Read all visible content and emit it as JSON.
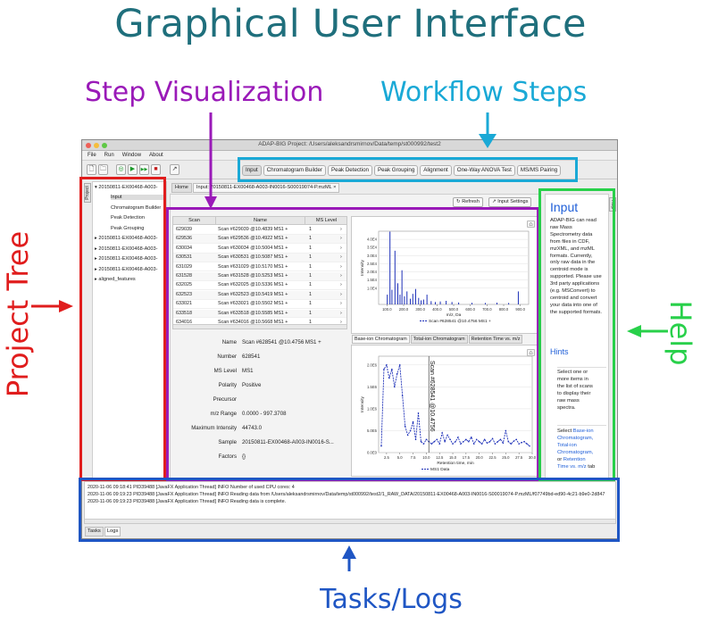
{
  "annotations": {
    "title": "Graphical User Interface",
    "step_visualization": "Step Visualization",
    "workflow_steps": "Workflow Steps",
    "project_tree": "Project Tree",
    "help": "Help",
    "tasks_logs": "Tasks/Logs",
    "colors": {
      "title": "#1f6f7c",
      "project_tree": "#e01d1d",
      "step_visualization": "#9a1ab8",
      "workflow_steps": "#1aa9d6",
      "help": "#28d04a",
      "tasks_logs": "#1f56c4"
    }
  },
  "window": {
    "title": "ADAP-BIG Project: /Users/aleksandrsmirnov/Data/temp/st000992/test2",
    "menu": [
      "File",
      "Run",
      "Window",
      "About"
    ],
    "toolbar_icons": [
      "new-file-icon",
      "open-folder-icon",
      "run-step-icon",
      "play-icon",
      "fast-forward-icon",
      "stop-icon",
      "pin-icon"
    ],
    "toolbar_glyphs": [
      "🗋",
      "🗀",
      "◎",
      "▶",
      "▶▶",
      "■",
      "↗"
    ],
    "workflow_steps": [
      "Input",
      "Chromatogram Builder",
      "Peak Detection",
      "Peak Grouping",
      "Alignment",
      "One-Way ANOVA Test",
      "MS/MS Pairing"
    ],
    "active_step": "Input"
  },
  "project_tree": {
    "tab_label": "Project",
    "nodes": [
      {
        "label": "▾ 20150811-EX00468-A003-",
        "selected": false
      },
      {
        "label": "Input",
        "selected": true
      },
      {
        "label": "Chromatogram Builder",
        "selected": false
      },
      {
        "label": "Peak Detection",
        "selected": false
      },
      {
        "label": "Peak Grouping",
        "selected": false
      },
      {
        "label": "▸ 20150811-EX00468-A003-",
        "selected": false
      },
      {
        "label": "▸ 20150811-EX00468-A003-",
        "selected": false
      },
      {
        "label": "▸ 20150811-EX00468-A003-",
        "selected": false
      },
      {
        "label": "▸ 20150811-EX00468-A003-",
        "selected": false
      },
      {
        "label": "▸ aligned_features",
        "selected": false
      }
    ]
  },
  "center": {
    "tabs": [
      "Home",
      "Input: 20150811-EX00468-A003-IN0016-S00019074-P.mzML ×"
    ],
    "refresh_label": "Refresh",
    "input_settings_label": "Input Settings",
    "table": {
      "columns": [
        "Scan",
        "Name",
        "MS Level"
      ],
      "rows": [
        [
          "629039",
          "Scan #629039 @10.4839 MS1 +",
          "1"
        ],
        [
          "629536",
          "Scan #629536 @10.4922 MS1 +",
          "1"
        ],
        [
          "630034",
          "Scan #630034 @10.5004 MS1 +",
          "1"
        ],
        [
          "630531",
          "Scan #630531 @10.5087 MS1 +",
          "1"
        ],
        [
          "631029",
          "Scan #631029 @10.5170 MS1 +",
          "1"
        ],
        [
          "631528",
          "Scan #631528 @10.5253 MS1 +",
          "1"
        ],
        [
          "632025",
          "Scan #632025 @10.5336 MS1 +",
          "1"
        ],
        [
          "632523",
          "Scan #632523 @10.5419 MS1 +",
          "1"
        ],
        [
          "633021",
          "Scan #633021 @10.5502 MS1 +",
          "1"
        ],
        [
          "633518",
          "Scan #633518 @10.5585 MS1 +",
          "1"
        ],
        [
          "634016",
          "Scan #634016 @10.5668 MS1 +",
          "1"
        ]
      ]
    },
    "details": [
      {
        "label": "Name",
        "value": "Scan #628541 @10.4756 MS1 +"
      },
      {
        "label": "Number",
        "value": "628541"
      },
      {
        "label": "MS Level",
        "value": "MS1"
      },
      {
        "label": "Polarity",
        "value": "Positive"
      },
      {
        "label": "Precursor",
        "value": ""
      },
      {
        "label": "m/z Range",
        "value": "0.0000 - 997.3708"
      },
      {
        "label": "Maximum Intensity",
        "value": "44743.0"
      },
      {
        "label": "Sample",
        "value": "20150811-EX00468-A003-IN0016-S..."
      },
      {
        "label": "Factors",
        "value": "{}"
      }
    ],
    "chromatogram_tabs": [
      "Base-ion Chromatogram",
      "Total-ion Chromatogram",
      "Retention Time vs. m/z"
    ]
  },
  "chart_data": [
    {
      "type": "bar",
      "xlabel": "m/z, Da",
      "ylabel": "Intensity",
      "x_ticks": [
        "100.0",
        "200.0",
        "300.0",
        "400.0",
        "500.0",
        "600.0",
        "700.0",
        "800.0",
        "900.0"
      ],
      "y_ticks": [
        "1.0E4",
        "1.5E4",
        "2.0E4",
        "2.5E4",
        "3.0E4",
        "3.5E4",
        "4.0E4"
      ],
      "xlim": [
        50,
        950
      ],
      "ylim": [
        0,
        45000
      ],
      "legend": "Scan #628541 @10.4756 MS1 +",
      "x": [
        102,
        118,
        130,
        148,
        165,
        178,
        190,
        205,
        220,
        240,
        255,
        272,
        290,
        305,
        320,
        340,
        365,
        390,
        420,
        455,
        490,
        530,
        610,
        690,
        760,
        830,
        888
      ],
      "y": [
        6000,
        44743,
        9000,
        33000,
        13000,
        6000,
        21000,
        5000,
        8000,
        3500,
        6500,
        9500,
        4000,
        2500,
        3000,
        6000,
        2000,
        1500,
        1800,
        2200,
        1500,
        1200,
        1000,
        900,
        1100,
        900,
        8000
      ]
    },
    {
      "type": "line",
      "xlabel": "Retention time, min",
      "ylabel": "Intensity",
      "x_ticks": [
        "2.5",
        "5.0",
        "7.5",
        "10.0",
        "12.5",
        "15.0",
        "17.5",
        "20.0",
        "22.5",
        "25.0",
        "27.5",
        "30.0"
      ],
      "y_ticks": [
        "0.0E0",
        "5.0E5",
        "1.0E6",
        "1.5E6",
        "2.0E6"
      ],
      "xlim": [
        1,
        30
      ],
      "ylim": [
        0,
        2200000
      ],
      "legend": "MS1 Data",
      "marker_label": "Scan #628541 @10.4756",
      "marker_x": 10.4756,
      "x": [
        1.5,
        2.0,
        2.5,
        3.0,
        3.5,
        4.0,
        4.5,
        5.0,
        5.5,
        6.0,
        6.5,
        7.0,
        7.5,
        8.0,
        8.5,
        9.0,
        9.5,
        10.0,
        10.5,
        11.0,
        11.5,
        12.0,
        12.5,
        13.0,
        13.5,
        14.0,
        14.5,
        15.0,
        15.5,
        16.0,
        16.5,
        17.0,
        17.5,
        18.0,
        18.5,
        19.0,
        19.5,
        20.0,
        20.5,
        21.0,
        21.5,
        22.0,
        22.5,
        23.0,
        23.5,
        24.0,
        24.5,
        25.0,
        25.5,
        26.0,
        26.5,
        27.0,
        27.5,
        28.0,
        28.5,
        29.0,
        29.5
      ],
      "y": [
        150000,
        1900000,
        2000000,
        1700000,
        1900000,
        1500000,
        1800000,
        2000000,
        1300000,
        600000,
        400000,
        500000,
        700000,
        300000,
        900000,
        250000,
        200000,
        300000,
        250000,
        200000,
        250000,
        300000,
        200000,
        450000,
        250000,
        400000,
        300000,
        200000,
        250000,
        350000,
        200000,
        250000,
        300000,
        250000,
        350000,
        200000,
        300000,
        250000,
        200000,
        300000,
        220000,
        250000,
        320000,
        200000,
        250000,
        300000,
        220000,
        500000,
        250000,
        200000,
        260000,
        300000,
        200000,
        230000,
        250000,
        200000,
        150000
      ]
    }
  ],
  "help": {
    "tab_label": "Help",
    "heading": "Input",
    "lines": [
      "ADAP-BIG can read",
      "raw Mass",
      "Spectrometry data",
      "from files in CDF,",
      "mzXML, and mzML",
      "formats. Currently,",
      "only raw data in the",
      "centroid mode is",
      "supported. Please use",
      "3rd party applications",
      "(e.g. MSConvert) to",
      "centroid and convert",
      "your data into one of",
      "the supported formats."
    ],
    "hints_heading": "Hints",
    "hint1_lines": [
      "Select one or",
      "more items in",
      "the list of scans",
      "to display their",
      "raw mass",
      "spectra."
    ],
    "hint2_prefix": "Select ",
    "hint2_link1": "Base-ion",
    "hint2_link1b": "Chromatogram,",
    "hint2_link2": "Total-ion",
    "hint2_link2b": "Chromatogram,",
    "hint2_or": "or ",
    "hint2_link3": "Retention",
    "hint2_link3b": "Time vs. m/z",
    "hint2_tail": " tab"
  },
  "logs": {
    "lines": [
      "2020-11-06 09:18:41 PID39488 [JavaFX Application Thread] INFO Number of used CPU cores: 4",
      "2020-11-06 09:19:23 PID39488 [JavaFX Application Thread] INFO Reading data from /Users/aleksandrsmirnov/Data/temp/st000992/test2/1_RAW_DATA/20150811-EX00468-A003-IN0016-S00019074-P.mzML/f07749bd-ed90-4c21-b9e0-2d847",
      "2020-11-06 09:19:23 PID39488 [JavaFX Application Thread] INFO Reading data is complete."
    ],
    "tabs": [
      "Tasks",
      "Logs"
    ]
  }
}
